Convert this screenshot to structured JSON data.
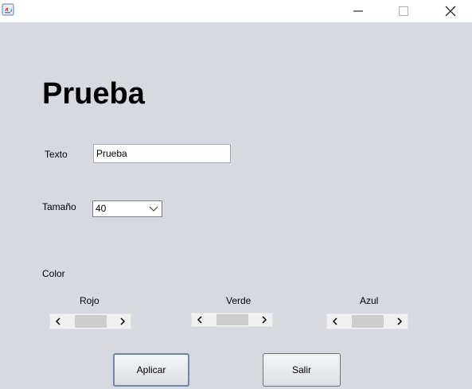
{
  "window": {
    "title": "",
    "controls": [
      "minimize-icon",
      "maximize-icon",
      "close-icon"
    ]
  },
  "main": {
    "heading": "Prueba",
    "texto_label": "Texto",
    "texto_value": "Prueba",
    "tamano_label": "Tamaño",
    "tamano_value": "40",
    "color_label": "Color"
  },
  "sliders": {
    "rojo": {
      "label": "Rojo",
      "value_fraction": 0.5
    },
    "verde": {
      "label": "Verde",
      "value_fraction": 0.5
    },
    "azul": {
      "label": "Azul",
      "value_fraction": 0.5
    }
  },
  "buttons": {
    "aplicar": "Aplicar",
    "salir": "Salir"
  },
  "colors": {
    "panel_background": "#d6d9e0",
    "focus_border": "#6f86ad"
  }
}
